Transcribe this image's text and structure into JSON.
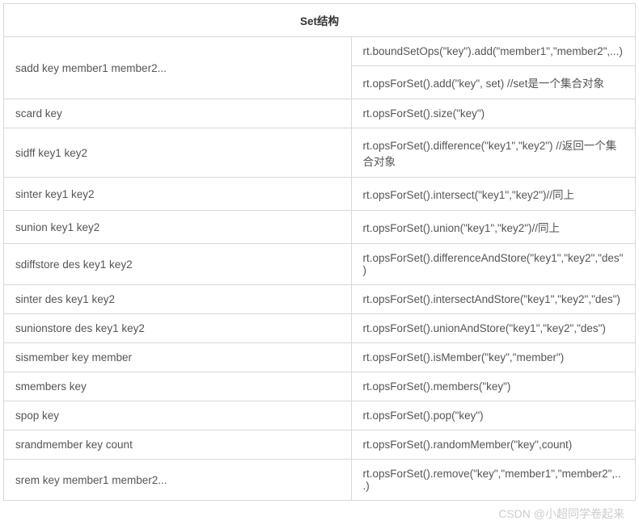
{
  "header": "Set结构",
  "rows": [
    {
      "left": "sadd key member1 member2...",
      "right": "rt.boundSetOps(\"key\").add(\"member1\",\"member2\",...)",
      "rowspan": 2
    },
    {
      "left": "",
      "right": "rt.opsForSet().add(\"key\", set) //set是一个集合对象",
      "merged": true
    },
    {
      "left": "scard key",
      "right": "rt.opsForSet().size(\"key\")"
    },
    {
      "left": "sidff key1 key2",
      "right": "rt.opsForSet().difference(\"key1\",\"key2\") //返回一个集合对象"
    },
    {
      "left": "sinter key1 key2",
      "right": "rt.opsForSet().intersect(\"key1\",\"key2\")//同上"
    },
    {
      "left": "sunion key1 key2",
      "right": "rt.opsForSet().union(\"key1\",\"key2\")//同上"
    },
    {
      "left": "sdiffstore des key1 key2",
      "right": "rt.opsForSet().differenceAndStore(\"key1\",\"key2\",\"des\")"
    },
    {
      "left": "sinter des key1 key2",
      "right": "rt.opsForSet().intersectAndStore(\"key1\",\"key2\",\"des\")"
    },
    {
      "left": "sunionstore des key1 key2",
      "right": "rt.opsForSet().unionAndStore(\"key1\",\"key2\",\"des\")"
    },
    {
      "left": "sismember key member",
      "right": "rt.opsForSet().isMember(\"key\",\"member\")"
    },
    {
      "left": "smembers key",
      "right": "rt.opsForSet().members(\"key\")"
    },
    {
      "left": "spop key",
      "right": "rt.opsForSet().pop(\"key\")"
    },
    {
      "left": "srandmember key count",
      "right": "rt.opsForSet().randomMember(\"key\",count)"
    },
    {
      "left": "srem key member1 member2...",
      "right": "rt.opsForSet().remove(\"key\",\"member1\",\"member2\",...)"
    }
  ],
  "watermark": "CSDN @小超同学卷起来"
}
